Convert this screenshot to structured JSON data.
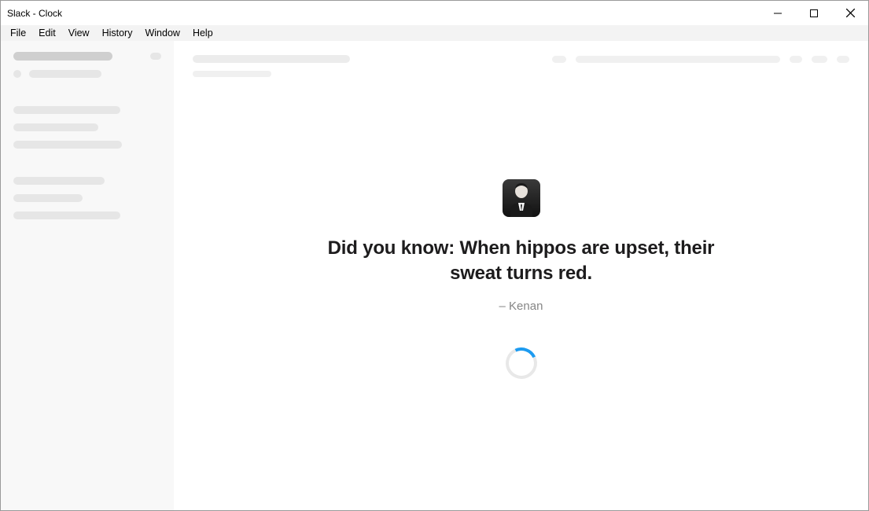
{
  "window": {
    "title": "Slack - Clock"
  },
  "menu": {
    "items": [
      "File",
      "Edit",
      "View",
      "History",
      "Window",
      "Help"
    ]
  },
  "loading": {
    "fact": "Did you know: When hippos are upset, their sweat turns red.",
    "attribution": "– Kenan"
  }
}
